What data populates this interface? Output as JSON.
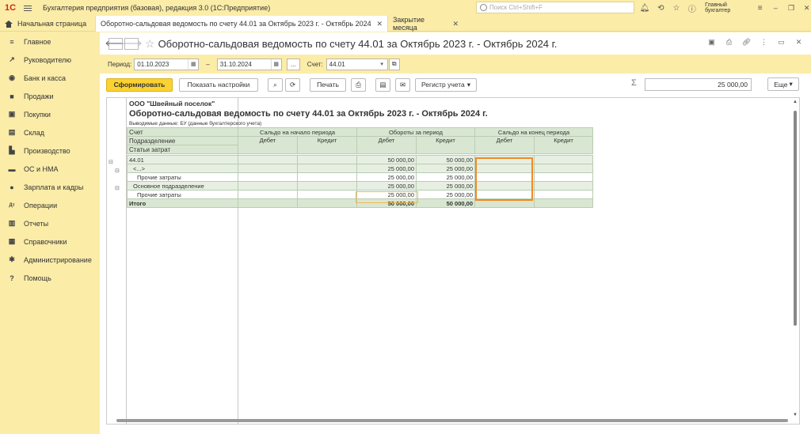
{
  "app": {
    "logo": "1С",
    "title": "Бухгалтерия предприятия (базовая), редакция 3.0  (1С:Предприятие)",
    "search_placeholder": "Поиск Ctrl+Shift+F",
    "user": "Главный бухгалтер"
  },
  "tabs": [
    {
      "label": "Начальная страница"
    },
    {
      "label": "Оборотно-сальдовая ведомость по счету 44.01 за Октябрь 2023 г. - Октябрь 2024 г."
    },
    {
      "label": "Закрытие месяца"
    }
  ],
  "sidebar": {
    "items": [
      {
        "label": "Главное",
        "icon": "≡"
      },
      {
        "label": "Руководителю",
        "icon": "↗"
      },
      {
        "label": "Банк и касса",
        "icon": "◉"
      },
      {
        "label": "Продажи",
        "icon": "■"
      },
      {
        "label": "Покупки",
        "icon": "▣"
      },
      {
        "label": "Склад",
        "icon": "▤"
      },
      {
        "label": "Производство",
        "icon": "▙"
      },
      {
        "label": "ОС и НМА",
        "icon": "▬"
      },
      {
        "label": "Зарплата и кадры",
        "icon": "●"
      },
      {
        "label": "Операции",
        "icon": "Дт"
      },
      {
        "label": "Отчеты",
        "icon": "▥"
      },
      {
        "label": "Справочники",
        "icon": "▦"
      },
      {
        "label": "Администрирование",
        "icon": "✱"
      },
      {
        "label": "Помощь",
        "icon": "?"
      }
    ]
  },
  "document": {
    "title": "Оборотно-сальдовая ведомость по счету 44.01 за Октябрь 2023 г. - Октябрь 2024 г."
  },
  "params": {
    "period_label": "Период:",
    "date_from": "01.10.2023",
    "dash": "–",
    "date_to": "31.10.2024",
    "dots": "...",
    "account_label": "Счет:",
    "account": "44.01"
  },
  "toolbar": {
    "generate": "Сформировать",
    "show_settings": "Показать настройки",
    "print": "Печать",
    "register": "Регистр учета",
    "sum_value": "25 000,00",
    "more": "Еще"
  },
  "report": {
    "org": "ООО \"Швейный поселок\"",
    "title": "Оборотно-сальдовая ведомость по счету 44.01 за Октябрь 2023 г. - Октябрь 2024 г.",
    "subtitle": "Выводимые данные: БУ (данные бухгалтерского учета)",
    "headers": {
      "account": "Счет",
      "division": "Подразделение",
      "cost_item": "Статьи затрат",
      "opening": "Сальдо на начало периода",
      "turnover": "Обороты за период",
      "closing": "Сальдо на конец периода",
      "debit": "Дебет",
      "credit": "Кредит"
    },
    "rows": [
      {
        "name": "44.01",
        "t_debit": "50 000,00",
        "t_credit": "50 000,00"
      },
      {
        "name": "<...>",
        "t_debit": "25 000,00",
        "t_credit": "25 000,00"
      },
      {
        "name": "Прочие затраты",
        "t_debit": "25 000,00",
        "t_credit": "25 000,00"
      },
      {
        "name": "Основное подразделение",
        "t_debit": "25 000,00",
        "t_credit": "25 000,00"
      },
      {
        "name": "Прочие затраты",
        "t_debit": "25 000,00",
        "t_credit": "25 000,00"
      }
    ],
    "total": {
      "name": "Итого",
      "t_debit": "50 000,00",
      "t_credit": "50 000,00"
    }
  }
}
